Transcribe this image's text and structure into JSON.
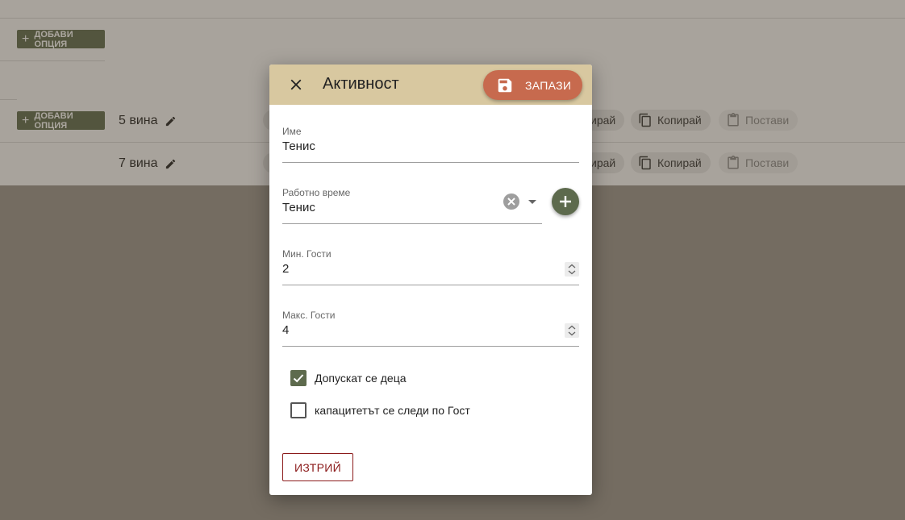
{
  "background": {
    "add_option_label": "ДОБАВИ ОПЦИЯ",
    "rows": [
      {
        "name": "5 вина"
      },
      {
        "name": "7 вина"
      }
    ],
    "chips": {
      "prev_label": "ирай",
      "copy_label": "Копирай",
      "paste_label": "Постави"
    }
  },
  "dialog": {
    "title": "Активност",
    "save_label": "ЗАПАЗИ",
    "name_field": {
      "label": "Име",
      "value": "Тенис"
    },
    "hours_field": {
      "label": "Работно време",
      "value": "Тенис"
    },
    "min_guests": {
      "label": "Мин. Гости",
      "value": "2"
    },
    "max_guests": {
      "label": "Макс. Гости",
      "value": "4"
    },
    "checkboxes": [
      {
        "label": "Допускат се деца",
        "checked": true
      },
      {
        "label": "капацитетът се следи по Гост",
        "checked": false
      }
    ],
    "delete_label": "ИЗТРИЙ"
  },
  "colors": {
    "accent": "#5d6a4d",
    "header": "#d8c8a0",
    "save": "#c76a4e",
    "delete": "#8b1a1a"
  }
}
